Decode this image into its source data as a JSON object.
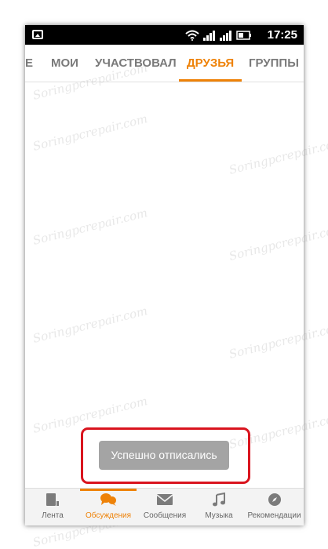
{
  "status_bar": {
    "time": "17:25",
    "icons": [
      "image-icon",
      "wifi-icon",
      "signal-icon",
      "signal-icon",
      "battery-icon"
    ]
  },
  "tabs": [
    {
      "label": "Е",
      "active": false
    },
    {
      "label": "МОИ",
      "active": false
    },
    {
      "label": "УЧАСТВОВАЛ",
      "active": false
    },
    {
      "label": "ДРУЗЬЯ",
      "active": true
    },
    {
      "label": "ГРУППЫ",
      "active": false
    }
  ],
  "toast": {
    "message": "Успешно отписались"
  },
  "bottom_nav": {
    "items": [
      {
        "label": "Лента",
        "icon": "feed-icon",
        "active": false
      },
      {
        "label": "Обсуждения",
        "icon": "discussions-icon",
        "active": true
      },
      {
        "label": "Сообщения",
        "icon": "envelope-icon",
        "active": false
      },
      {
        "label": "Музыка",
        "icon": "music-note-icon",
        "active": false
      },
      {
        "label": "Рекомендации",
        "icon": "compass-icon",
        "active": false
      }
    ]
  },
  "watermark": {
    "text": "Soringpcrepair.com"
  },
  "colors": {
    "accent": "#ee8208",
    "highlight_frame": "#d9141e",
    "toast_background": "#a4a4a4",
    "status_bar": "#000000"
  }
}
